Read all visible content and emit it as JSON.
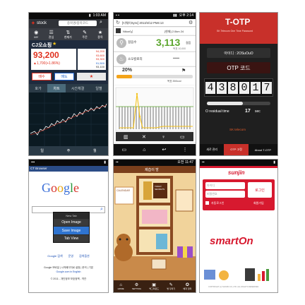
{
  "p1": {
    "status_time": "1:03 AM",
    "app_name": "stock",
    "header_text": "종목명/종목코드",
    "nav_items": [
      "MY",
      "관심",
      "현재가",
      "주문",
      "종목"
    ],
    "stock_name": "CJ오쇼핑",
    "price": "93,200",
    "change": "▲1,700(+1.86%)",
    "detail_values": [
      "94,200",
      "93,600",
      "93,300",
      "91,500",
      "93,100"
    ],
    "buy_label": "매수",
    "sell_label": "매도",
    "tabs": [
      "호가",
      "차트",
      "시간체결",
      "일별"
    ],
    "bottom_items": [
      "일",
      "주",
      "월"
    ],
    "colors": {
      "header": "#3a3d44",
      "quote_bg": "#1f2b3e",
      "up": "#e0301e",
      "chart_bg": "#0b1a22"
    }
  },
  "p2": {
    "status_time": "오후 2:14",
    "header_text": "[티웨이Sync] 2013/4/12 PM4:13",
    "user_label": "Nikon님",
    "user_info": "[현재]  2.0km  24",
    "steps_label": "걸음수",
    "steps_value": "3,113",
    "steps_unit": "걸음",
    "steps_sub": "목표 10,000",
    "calories_label": "소모칼로리",
    "calories_value": "━━━",
    "percent": "20%",
    "target_label": "목표 350kcal",
    "bottom_icons": [
      "chart-icon",
      "tools-icon",
      "bulb-icon",
      "screen-icon"
    ]
  },
  "p3": {
    "logo_text": "T-OTP",
    "logo_sub": "SK Telecom One Time Password",
    "id_label": "아이디 : 2OSuOuO",
    "otp_title": "OTP 코드",
    "otp_digits": [
      "4",
      "3",
      "8",
      "0",
      "1",
      "7"
    ],
    "remaining_label": "O residual time",
    "remaining_value": "17",
    "remaining_unit": "sec",
    "brand": "SK telecom",
    "bottom_items": [
      "새로 관리",
      "OTP 고정",
      "About T-OTP"
    ],
    "remaining_fraction": 0.57
  },
  "p4": {
    "browser_title": "CT Browser",
    "google_letters": [
      "G",
      "o",
      "o",
      "g",
      "l",
      "e"
    ],
    "menu_items": [
      "Open Image",
      "Save Image",
      "Tab View"
    ],
    "menu_header": "New Tab",
    "links": [
      "Google 검색",
      "운영",
      "검색옵션"
    ],
    "footer_line1": "Google 모바일 | 시작페이지로 설정 | 문의 | 기본",
    "footer_line2": "Google.com in English",
    "footer_line3": "© 2011 - 개인정보 보호정책 - 약관"
  },
  "p5": {
    "status_time": "오전 11:47",
    "title": "제습이 방",
    "book_label": "TODAY SECRETS",
    "calendar_label": "CALENDAR",
    "bottom_items": [
      "HOME",
      "SETTING",
      "백그라운드",
      "방 꾸미기",
      "배지 정리"
    ]
  },
  "p6": {
    "brand": "sunjin",
    "id_placeholder": "아이디",
    "pw_placeholder": "비밀번호",
    "login_label": "로그인",
    "auto_login": "자동로그인",
    "join_label": "회원가입",
    "logo_text": "smart",
    "logo_on": "On",
    "copyright": "COPYRIGHT (c) SUNJIN CO.,LTD. ALL RIGHTS RESERVED."
  }
}
